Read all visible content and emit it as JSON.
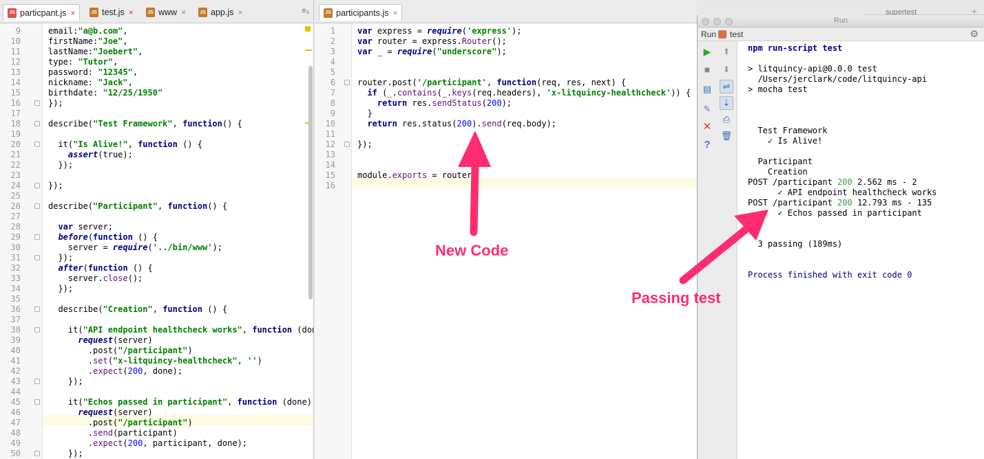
{
  "left_editor": {
    "tabs": [
      {
        "label": "particpant.js",
        "close": "×"
      },
      {
        "label": "test.js",
        "close": "×"
      },
      {
        "label": "www",
        "close": "×"
      },
      {
        "label": "app.js",
        "close": "×"
      }
    ],
    "tabs_overflow": "≡₃",
    "line_numbers": [
      "9",
      "10",
      "11",
      "12",
      "13",
      "14",
      "15",
      "16",
      "17",
      "18",
      "19",
      "20",
      "21",
      "22",
      "23",
      "24",
      "25",
      "26",
      "27",
      "28",
      "29",
      "30",
      "31",
      "32",
      "33",
      "34",
      "35",
      "36",
      "37",
      "38",
      "39",
      "40",
      "41",
      "42",
      "43",
      "44",
      "45",
      "46",
      "47",
      "48",
      "49",
      "50"
    ],
    "lines": [
      "email:\"a@b.com\",",
      "firstName:\"Joe\",",
      "lastName:\"Joebert\",",
      "type: \"Tutor\",",
      "password: \"12345\",",
      "nickname: \"Jack\",",
      "birthdate: \"12/25/1950\"",
      "});",
      "",
      "describe(\"Test Framework\", function() {",
      "",
      "  it(\"Is Alive!\", function () {",
      "    assert(true);",
      "  });",
      "",
      "});",
      "",
      "describe(\"Participant\", function() {",
      "",
      "  var server;",
      "  before(function () {",
      "    server = require('../bin/www');",
      "  });",
      "  after(function () {",
      "    server.close();",
      "  });",
      "",
      "  describe(\"Creation\", function () {",
      "",
      "    it(\"API endpoint healthcheck works\", function (done",
      "      request(server)",
      "        .post(\"/participant\")",
      "        .set(\"x-litquincy-healthcheck\", '')",
      "        .expect(200, done);",
      "    });",
      "",
      "    it(\"Echos passed in participant\", function (done) {",
      "      request(server)",
      "        .post(\"/participant\")",
      "        .send(participant)",
      "        .expect(200, participant, done);",
      "    });"
    ]
  },
  "mid_editor": {
    "tab": {
      "label": "participants.js",
      "close": "×"
    },
    "line_numbers": [
      "1",
      "2",
      "3",
      "4",
      "5",
      "6",
      "7",
      "8",
      "9",
      "10",
      "11",
      "12",
      "13",
      "14",
      "15",
      "16"
    ],
    "lines": [
      "var express = require('express');",
      "var router = express.Router();",
      "var _ = require(\"underscore\");",
      "",
      "",
      "router.post('/participant', function(req, res, next) {",
      "  if (_.contains(_.keys(req.headers), 'x-litquincy-healthcheck')) {",
      "    return res.sendStatus(200);",
      "  }",
      "  return res.status(200).send(req.body);",
      "",
      "});",
      "",
      "",
      "module.exports = router;",
      ""
    ]
  },
  "run_window": {
    "window_title": "Run",
    "header_label": "Run",
    "config_name": "test",
    "console_lines": [
      {
        "text": "npm run-script test",
        "style": "cmd"
      },
      {
        "text": "",
        "style": "plain"
      },
      {
        "text": "> litquincy-api@0.0.0 test",
        "style": "plain"
      },
      {
        "text": "  /Users/jerclark/code/litquincy-api",
        "style": "plain"
      },
      {
        "text": "> mocha test",
        "style": "plain"
      },
      {
        "text": "",
        "style": "plain"
      },
      {
        "text": "",
        "style": "plain"
      },
      {
        "text": "",
        "style": "plain"
      },
      {
        "text": "  Test Framework",
        "style": "plain"
      },
      {
        "text": "    ✓ Is Alive!",
        "style": "plain"
      },
      {
        "text": "",
        "style": "plain"
      },
      {
        "text": "  Participant",
        "style": "plain"
      },
      {
        "text": "    Creation",
        "style": "plain"
      },
      {
        "text": "POST /participant 200 2.562 ms - 2",
        "style": "http"
      },
      {
        "text": "      ✓ API endpoint healthcheck works",
        "style": "plain"
      },
      {
        "text": "POST /participant 200 12.793 ms - 135",
        "style": "http"
      },
      {
        "text": "      ✓ Echos passed in participant",
        "style": "plain"
      },
      {
        "text": "",
        "style": "plain"
      },
      {
        "text": "",
        "style": "plain"
      },
      {
        "text": "  3 passing (189ms)",
        "style": "plain"
      },
      {
        "text": "",
        "style": "plain"
      },
      {
        "text": "",
        "style": "plain"
      },
      {
        "text": "Process finished with exit code 0",
        "style": "exit"
      }
    ]
  },
  "background_window": {
    "tab_label": "supertest",
    "plus": "+"
  },
  "annotations": {
    "new_code": "New Code",
    "passing_test": "Passing test"
  },
  "colors": {
    "annotation": "#ff2d6f",
    "status_ok": "#3c9a3c",
    "keyword": "#000080",
    "string": "#008000",
    "number": "#0000ff"
  }
}
